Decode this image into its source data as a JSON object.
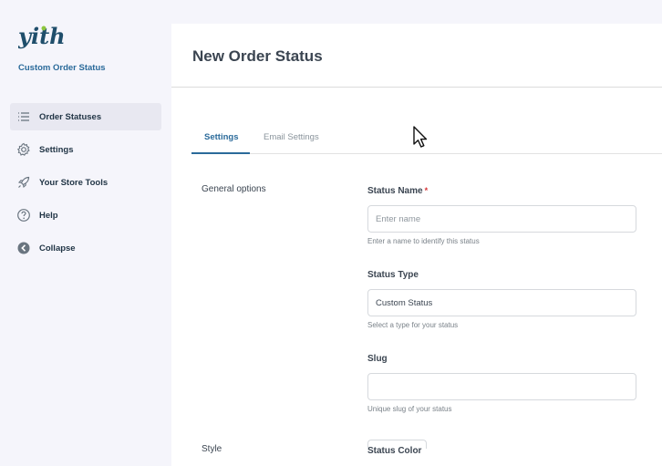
{
  "brand": {
    "logo_text": "yith",
    "plugin_name": "Custom Order Status"
  },
  "sidebar": {
    "items": [
      {
        "label": "Order Statuses",
        "icon": "list-icon",
        "active": true
      },
      {
        "label": "Settings",
        "icon": "gear-icon",
        "active": false
      },
      {
        "label": "Your Store Tools",
        "icon": "rocket-icon",
        "active": false
      },
      {
        "label": "Help",
        "icon": "help-icon",
        "active": false
      },
      {
        "label": "Collapse",
        "icon": "collapse-icon",
        "active": false
      }
    ]
  },
  "page": {
    "title": "New Order Status"
  },
  "tabs": [
    {
      "label": "Settings",
      "active": true
    },
    {
      "label": "Email Settings",
      "active": false
    }
  ],
  "form": {
    "general_section": "General options",
    "status_name": {
      "label": "Status Name",
      "required_mark": "*",
      "placeholder": "Enter name",
      "value": "",
      "help": "Enter a name to identify this status"
    },
    "status_type": {
      "label": "Status Type",
      "value": "Custom Status",
      "help": "Select a type for your status"
    },
    "slug": {
      "label": "Slug",
      "value": "",
      "help": "Unique slug of your status"
    },
    "style_section": "Style",
    "status_color": {
      "label": "Status Color"
    }
  },
  "colors": {
    "accent": "#2a6a9a",
    "required": "#d63638",
    "logo": "#1f4e6b",
    "logo_dot": "#8dc63f"
  }
}
